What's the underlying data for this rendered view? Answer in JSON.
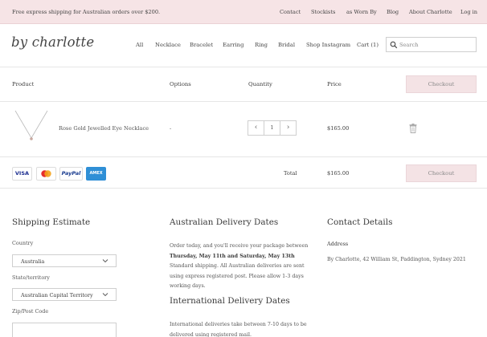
{
  "topbar": {
    "promo": "Free express shipping for Australian orders over $200.",
    "links": [
      "Contact",
      "Stockists",
      "as Worn By",
      "Blog",
      "About Charlotte",
      "Log in"
    ]
  },
  "header": {
    "logo": "by charlotte",
    "nav": [
      "All",
      "Necklace",
      "Bracelet",
      "Earring",
      "Ring",
      "Bridal",
      "Shop Instagram",
      "Cart (1)"
    ],
    "search_placeholder": "Search"
  },
  "cart": {
    "columns": {
      "product": "Product",
      "options": "Options",
      "quantity": "Quantity",
      "price": "Price"
    },
    "checkout_label": "Checkout",
    "items": [
      {
        "name": "Rose Gold Jewelled Eye Necklace",
        "options": "-",
        "quantity": "1",
        "price": "$165.00"
      }
    ],
    "payment_cards": [
      "VISA",
      "MasterCard",
      "PayPal",
      "AMEX"
    ],
    "total_label": "Total",
    "total_value": "$165.00"
  },
  "shipping_estimate": {
    "title": "Shipping Estimate",
    "country_label": "Country",
    "country_value": "Australia",
    "state_label": "State/territory",
    "state_value": "Australian Capital Territory",
    "zip_label": "Zip/Post Code"
  },
  "delivery": {
    "au_title": "Australian Delivery Dates",
    "au_text_1": "Order today, and you'll receive your package between",
    "au_bold": "Thursday, May 11th and Saturday, May 13th",
    "au_text_2": "Standard shipping. All Australian deliveries are sent using express registered post. Please allow 1-3 days working days.",
    "intl_title": "International Delivery Dates",
    "intl_text": "International deliveries take between 7-10 days to be delivered using registered mail."
  },
  "contact": {
    "title": "Contact Details",
    "address_label": "Address",
    "address": "By Charlotte, 42 William St, Paddington, Sydney 2021"
  },
  "colors": {
    "accent_pink": "#f4e3e5",
    "text": "#3a3a3a"
  }
}
